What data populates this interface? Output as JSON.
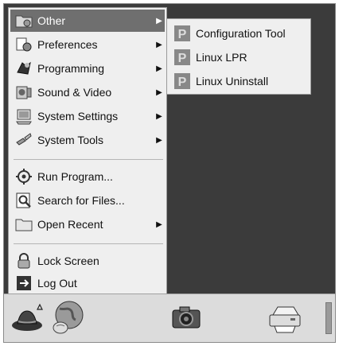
{
  "menu": {
    "items": [
      {
        "label": "Other",
        "icon": "folder-icon",
        "has_submenu": true,
        "selected": true
      },
      {
        "label": "Preferences",
        "icon": "preferences-icon",
        "has_submenu": true
      },
      {
        "label": "Programming",
        "icon": "programming-icon",
        "has_submenu": true
      },
      {
        "label": "Sound & Video",
        "icon": "sound-video-icon",
        "has_submenu": true
      },
      {
        "label": "System Settings",
        "icon": "system-settings-icon",
        "has_submenu": true
      },
      {
        "label": "System Tools",
        "icon": "system-tools-icon",
        "has_submenu": true
      },
      {
        "label": "Run Program...",
        "icon": "run-program-icon",
        "has_submenu": false
      },
      {
        "label": "Search for Files...",
        "icon": "search-files-icon",
        "has_submenu": false
      },
      {
        "label": "Open Recent",
        "icon": "folder-icon",
        "has_submenu": true
      },
      {
        "label": "Lock Screen",
        "icon": "lock-icon",
        "has_submenu": false
      },
      {
        "label": "Log Out",
        "icon": "logout-icon",
        "has_submenu": false
      }
    ]
  },
  "submenu": {
    "items": [
      {
        "label": "Configuration Tool",
        "icon": "printer-tool-icon"
      },
      {
        "label": "Linux LPR",
        "icon": "printer-tool-icon"
      },
      {
        "label": "Linux Uninstall",
        "icon": "printer-tool-icon"
      }
    ]
  },
  "panel": {
    "launchers": [
      {
        "name": "main-menu-redhat-icon"
      },
      {
        "name": "web-browser-icon"
      },
      {
        "name": "camera-icon"
      },
      {
        "name": "printer-icon"
      }
    ]
  }
}
